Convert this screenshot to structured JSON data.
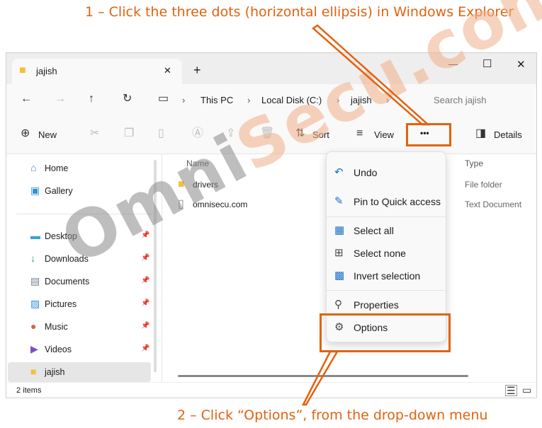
{
  "annotations": {
    "top": "1 – Click the three dots (horizontal ellipsis) in Windows Explorer",
    "bottom": "2 – Click “Options”, from the drop-down menu",
    "color": "#e2620f"
  },
  "watermark": {
    "part1": "Omni",
    "part2": "Secu.com"
  },
  "tab": {
    "title": "jajish",
    "close": "✕",
    "new_tab": "+"
  },
  "window_controls": {
    "minimize": "—",
    "maximize": "☐",
    "close": "✕"
  },
  "address": {
    "back": "←",
    "forward": "→",
    "up": "↑",
    "refresh": "↻",
    "breadcrumbs": [
      "This PC",
      "Local Disk (C:)",
      "jajish"
    ],
    "search_placeholder": "Search jajish"
  },
  "toolbar": {
    "new": "New",
    "sort": "Sort",
    "view": "View",
    "more": "•••",
    "details": "Details"
  },
  "sidebar": {
    "items": [
      {
        "label": "Home",
        "icon": "home-icon",
        "glyph": "⌂"
      },
      {
        "label": "Gallery",
        "icon": "gallery-icon",
        "glyph": "▣"
      },
      {
        "label": "Desktop",
        "icon": "desktop-icon",
        "glyph": "▬"
      },
      {
        "label": "Downloads",
        "icon": "download-icon",
        "glyph": "↓"
      },
      {
        "label": "Documents",
        "icon": "document-icon",
        "glyph": "▤"
      },
      {
        "label": "Pictures",
        "icon": "pictures-icon",
        "glyph": "▨"
      },
      {
        "label": "Music",
        "icon": "music-icon",
        "glyph": "●"
      },
      {
        "label": "Videos",
        "icon": "video-icon",
        "glyph": "▶"
      },
      {
        "label": "jajish",
        "icon": "folder-icon",
        "glyph": "■"
      }
    ]
  },
  "columns": {
    "name": "Name",
    "type": "Type"
  },
  "files": [
    {
      "name": "drivers",
      "type": "File folder"
    },
    {
      "name": "omnisecu.com",
      "type": "Text Document"
    }
  ],
  "menu": {
    "items": [
      {
        "label": "Undo",
        "icon": "undo-icon",
        "glyph": "↶"
      },
      {
        "label": "Pin to Quick access",
        "icon": "pin-icon",
        "glyph": "✎"
      },
      {
        "label": "Select all",
        "icon": "select-all-icon",
        "glyph": "▦"
      },
      {
        "label": "Select none",
        "icon": "select-none-icon",
        "glyph": "⊞"
      },
      {
        "label": "Invert selection",
        "icon": "invert-selection-icon",
        "glyph": "▩"
      },
      {
        "label": "Properties",
        "icon": "wrench-icon",
        "glyph": "⚲"
      },
      {
        "label": "Options",
        "icon": "gear-icon",
        "glyph": "⚙"
      }
    ]
  },
  "status": {
    "count": "2 items"
  }
}
